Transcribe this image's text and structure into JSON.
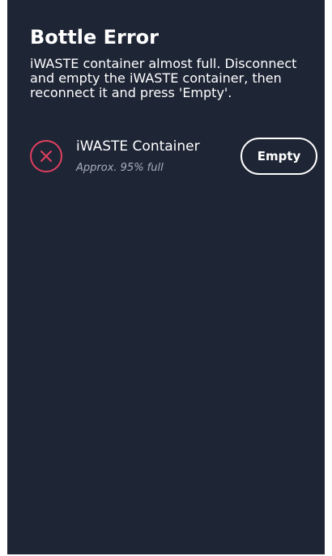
{
  "dialog": {
    "title": "Bottle Error",
    "message": "iWASTE container almost full. Disconnect and empty the iWASTE container, then reconnect it and press 'Empty'."
  },
  "item": {
    "icon": "error-x-circle-icon",
    "name": "iWASTE Container",
    "status": "Approx. 95% full",
    "fill_percent": 95,
    "action_label": "Empty"
  },
  "colors": {
    "background": "#1e2535",
    "error": "#e0405e",
    "text": "#ffffff",
    "muted_text": "#aab0bb"
  }
}
